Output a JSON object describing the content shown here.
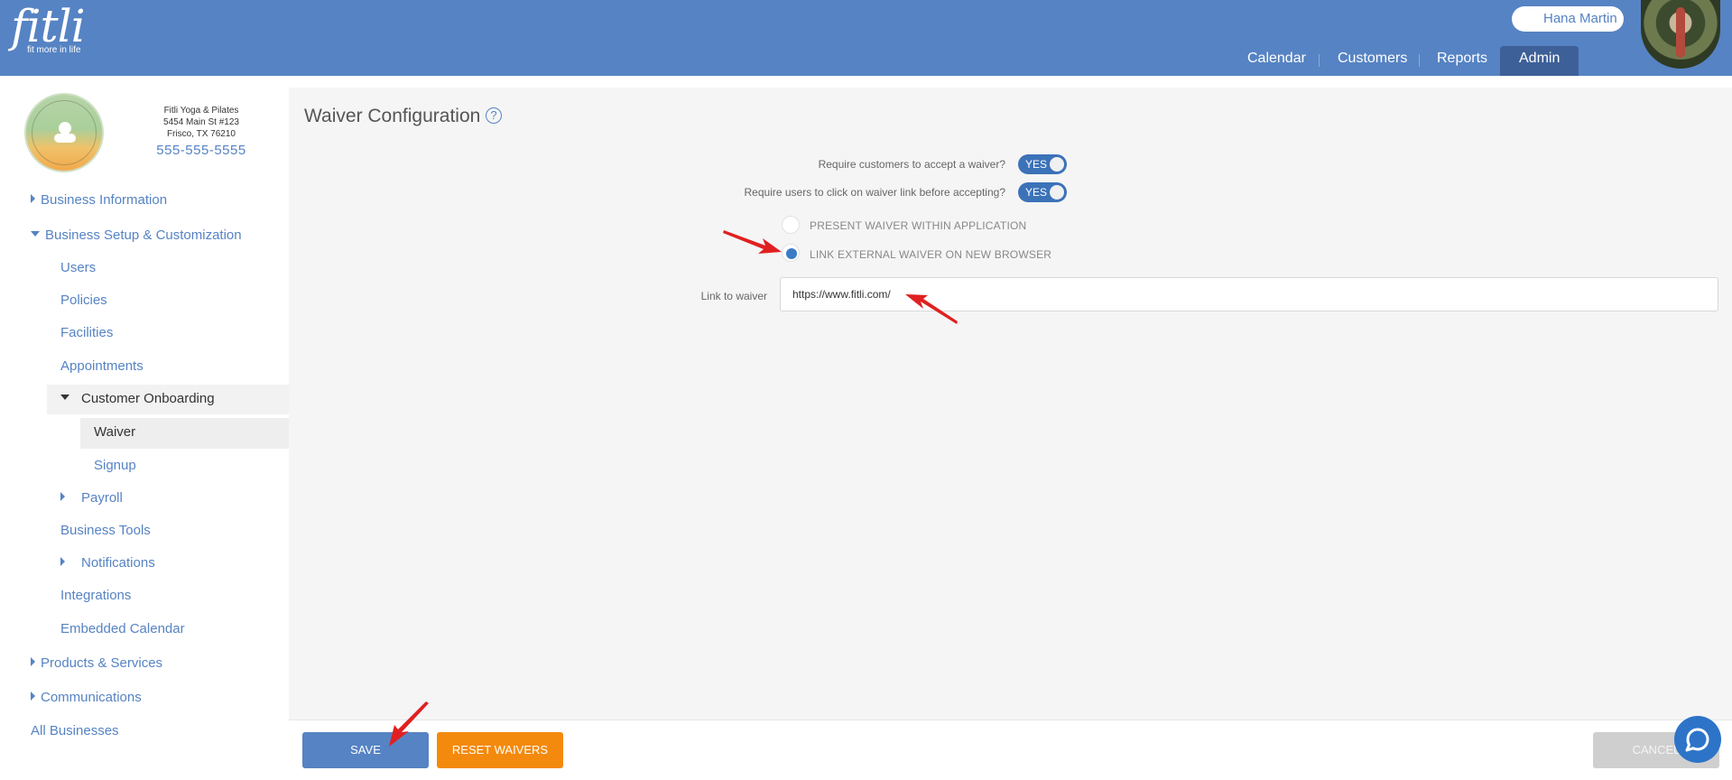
{
  "brand": {
    "word": "fitli",
    "tagline": "fit more in life"
  },
  "user": {
    "name": "Hana Martin"
  },
  "nav": {
    "calendar": "Calendar",
    "customers": "Customers",
    "reports": "Reports",
    "admin": "Admin"
  },
  "business": {
    "name": "Fitli Yoga & Pilates",
    "address1": "5454 Main St #123",
    "address2": "Frisco, TX 76210",
    "phone": "555-555-5555"
  },
  "sidebar": {
    "business_information": "Business Information",
    "business_setup": "Business Setup & Customization",
    "users": "Users",
    "policies": "Policies",
    "facilities": "Facilities",
    "appointments": "Appointments",
    "customer_onboarding": "Customer Onboarding",
    "waiver": "Waiver",
    "signup": "Signup",
    "payroll": "Payroll",
    "business_tools": "Business Tools",
    "notifications": "Notifications",
    "integrations": "Integrations",
    "embedded_calendar": "Embedded Calendar",
    "products_services": "Products & Services",
    "communications": "Communications",
    "all_businesses": "All Businesses"
  },
  "page": {
    "title": "Waiver Configuration",
    "help": "?",
    "require_accept_label": "Require customers to accept a waiver?",
    "require_accept_value": "YES",
    "require_click_label": "Require users to click on waiver link before accepting?",
    "require_click_value": "YES",
    "option_present": "PRESENT WAIVER WITHIN APPLICATION",
    "option_link": "LINK EXTERNAL WAIVER ON NEW BROWSER",
    "selected_option": "LINK EXTERNAL WAIVER ON NEW BROWSER",
    "link_label": "Link to waiver",
    "link_value": "https://www.fitli.com/"
  },
  "buttons": {
    "save": "SAVE",
    "reset": "RESET WAIVERS",
    "cancel": "CANCEL"
  },
  "colors": {
    "header": "#5683c3",
    "accent": "#3c72b8",
    "orange": "#f48a0d",
    "annotation_arrow": "#e02020"
  }
}
